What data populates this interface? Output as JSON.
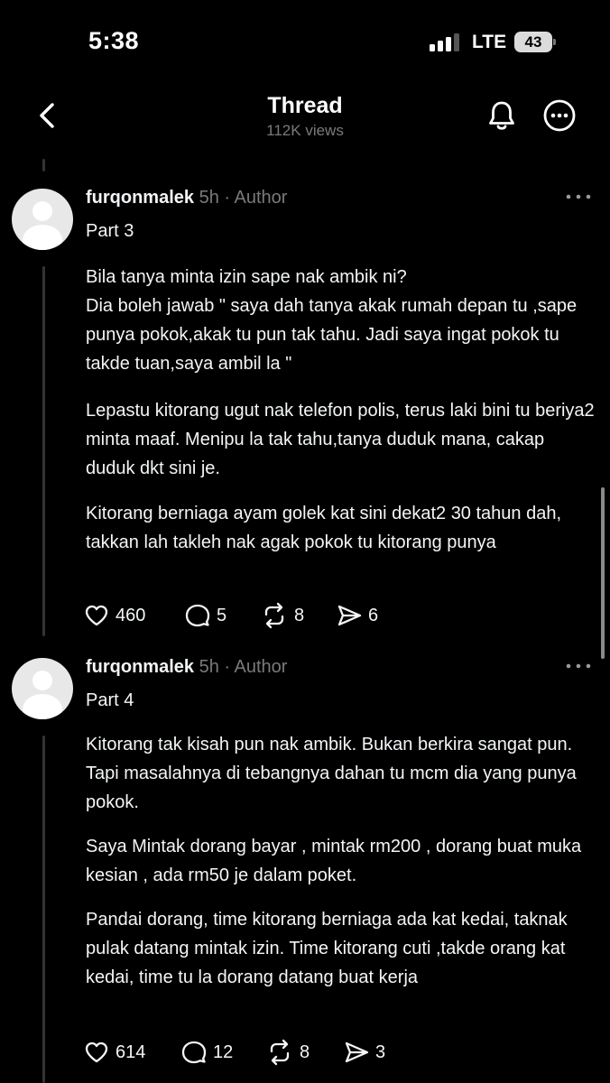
{
  "status": {
    "time": "5:38",
    "network": "LTE",
    "battery": "43"
  },
  "nav": {
    "title": "Thread",
    "views": "112K views"
  },
  "posts": [
    {
      "username": "furqonmalek",
      "meta": " 5h · Author",
      "part": "Part 3",
      "paragraphs": [
        "Bila tanya minta izin sape nak ambik ni?\nDia boleh jawab \" saya dah tanya akak rumah depan tu ,sape punya pokok,akak tu pun tak tahu. Jadi saya ingat pokok tu takde tuan,saya ambil la \"",
        "Lepastu kitorang ugut nak telefon polis, terus laki bini tu beriya2 minta maaf.  Menipu la tak tahu,tanya duduk mana, cakap duduk dkt sini je.",
        "Kitorang berniaga ayam golek kat sini dekat2 30 tahun dah, takkan lah takleh nak agak  pokok tu kitorang punya"
      ],
      "likes": "460",
      "replies": "5",
      "reposts": "8",
      "shares": "6"
    },
    {
      "username": "furqonmalek",
      "meta": " 5h · Author",
      "part": "Part 4",
      "paragraphs": [
        "Kitorang tak kisah pun nak ambik. Bukan berkira sangat pun. Tapi masalahnya di tebangnya dahan tu mcm dia yang punya pokok.",
        "Saya Mintak dorang bayar , mintak rm200 , dorang buat muka kesian , ada rm50 je dalam poket.",
        "Pandai dorang, time kitorang berniaga ada kat kedai,  taknak pulak datang mintak izin. Time kitorang cuti ,takde orang kat kedai, time tu la dorang datang buat kerja"
      ],
      "likes": "614",
      "replies": "12",
      "reposts": "8",
      "shares": "3"
    }
  ]
}
